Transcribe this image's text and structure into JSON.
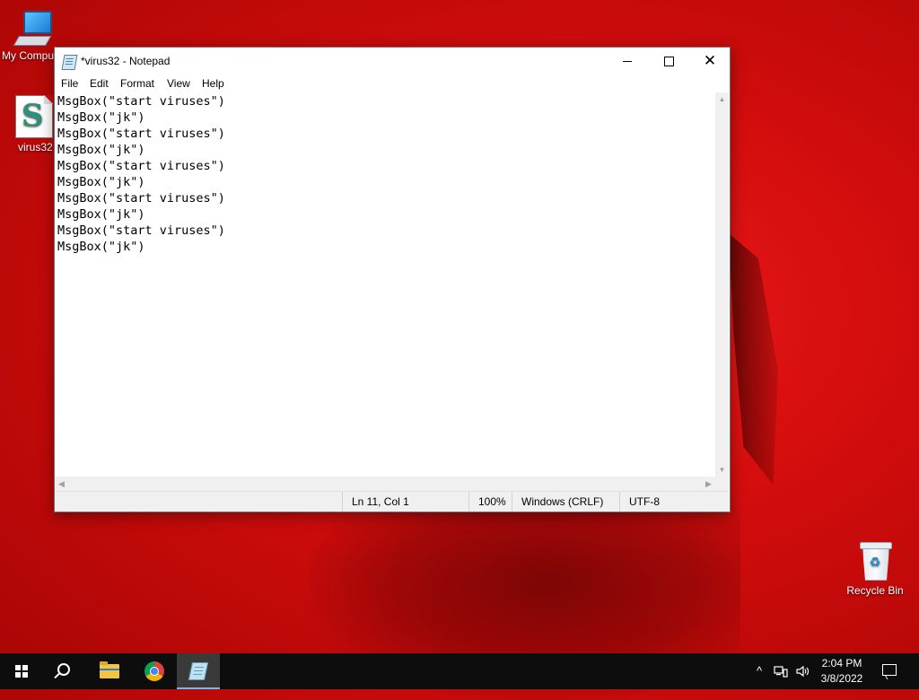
{
  "desktop": {
    "icons": [
      {
        "label": "My Compu"
      },
      {
        "label": "virus32"
      },
      {
        "label": "Recycle Bin"
      }
    ]
  },
  "window": {
    "title": "*virus32 - Notepad",
    "controls": {
      "minimize": "",
      "maximize": "",
      "close": "✕"
    }
  },
  "menu": [
    "File",
    "Edit",
    "Format",
    "View",
    "Help"
  ],
  "editor": {
    "text": "MsgBox(\"start viruses\")\nMsgBox(\"jk\")\nMsgBox(\"start viruses\")\nMsgBox(\"jk\")\nMsgBox(\"start viruses\")\nMsgBox(\"jk\")\nMsgBox(\"start viruses\")\nMsgBox(\"jk\")\nMsgBox(\"start viruses\")\nMsgBox(\"jk\")"
  },
  "status": {
    "position": "Ln 11, Col 1",
    "zoom": "100%",
    "line_ending": "Windows (CRLF)",
    "encoding": "UTF-8"
  },
  "taskbar": {
    "apps": [
      {
        "icon": "windows-start-icon"
      },
      {
        "icon": "search-icon"
      },
      {
        "icon": "file-explorer-icon"
      },
      {
        "icon": "chrome-icon"
      },
      {
        "icon": "notepad-icon",
        "active": true
      }
    ],
    "tray": {
      "chevron": "^"
    },
    "clock": {
      "time": "2:04 PM",
      "date": "3/8/2022"
    }
  },
  "colors": {
    "taskbar_bg": "#0d0d0d",
    "active_indicator": "#76b9ed",
    "desktop_red": "#d40d0d"
  }
}
